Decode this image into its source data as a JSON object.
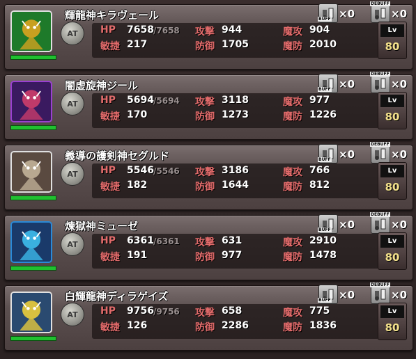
{
  "units": [
    {
      "name": "輝龍神キラヴェール",
      "hp": "7658",
      "hp_max": "/7658",
      "atk": "944",
      "matk": "904",
      "agi": "217",
      "def": "1705",
      "mdef": "2010",
      "lv": "80",
      "frame": "#e0e0e0",
      "bg": "#1e7a2a",
      "art": "#c8a020"
    },
    {
      "name": "闇虚旋神ジール",
      "hp": "5694",
      "hp_max": "/5694",
      "atk": "3118",
      "matk": "977",
      "agi": "170",
      "def": "1273",
      "mdef": "1226",
      "lv": "80",
      "frame": "#9a40d0",
      "bg": "#3a1a60",
      "art": "#c03a6a"
    },
    {
      "name": "義導の護剣神セグルド",
      "hp": "5546",
      "hp_max": "/5546",
      "atk": "3186",
      "matk": "766",
      "agi": "182",
      "def": "1644",
      "mdef": "812",
      "lv": "80",
      "frame": "#e0e0e0",
      "bg": "#5a4a40",
      "art": "#b8a890"
    },
    {
      "name": "煉獄神ミューゼ",
      "hp": "6361",
      "hp_max": "/6361",
      "atk": "631",
      "matk": "2910",
      "agi": "191",
      "def": "977",
      "mdef": "1478",
      "lv": "80",
      "frame": "#2a8ad8",
      "bg": "#1a3a6a",
      "art": "#3ab0e0"
    },
    {
      "name": "白輝龍神ディラゲイズ",
      "hp": "9756",
      "hp_max": "/9756",
      "atk": "658",
      "matk": "775",
      "agi": "126",
      "def": "2286",
      "mdef": "1836",
      "lv": "80",
      "frame": "#e0e0e0",
      "bg": "#2a4a70",
      "art": "#d8c040"
    }
  ],
  "labels": {
    "hp": "HP",
    "atk": "攻撃",
    "matk": "魔攻",
    "agi": "敏捷",
    "def": "防御",
    "mdef": "魔防",
    "lv": "Lv",
    "at": "AT",
    "buff": "BUFF",
    "debuff": "DEBUFF",
    "count": "×0"
  }
}
